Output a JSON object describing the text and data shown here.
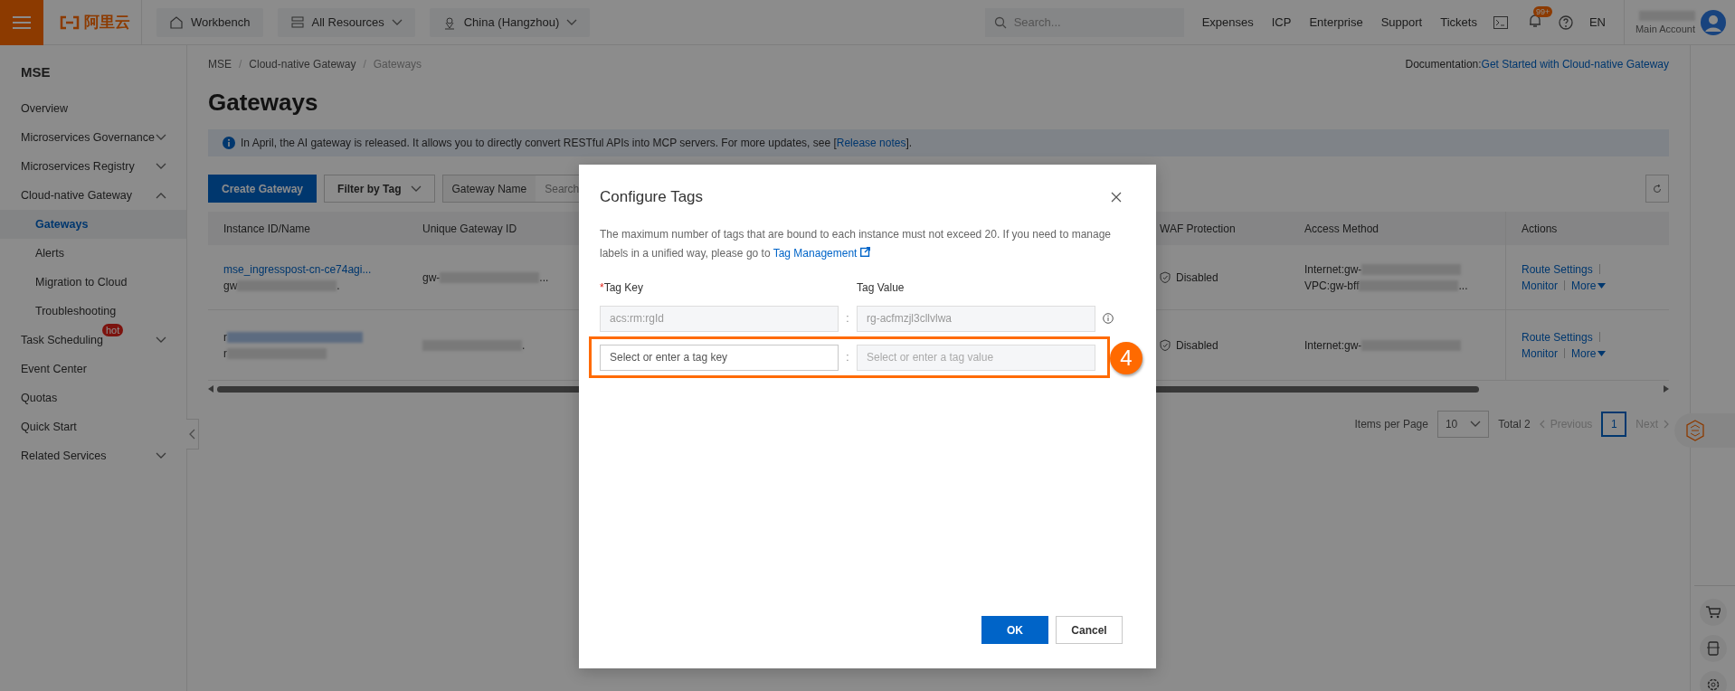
{
  "top_bar": {
    "logo": "阿里云",
    "nav_buttons": [
      {
        "label": "Workbench",
        "dropdown": false
      },
      {
        "label": "All Resources",
        "dropdown": true
      },
      {
        "label": "China (Hangzhou)",
        "dropdown": true
      }
    ],
    "search": {
      "placeholder": "Search..."
    },
    "links": [
      "Expenses",
      "ICP",
      "Enterprise",
      "Support",
      "Tickets"
    ],
    "notification_badge": "99+",
    "language": "EN",
    "account": {
      "type": "Main Account"
    }
  },
  "sidebar": {
    "title": "MSE",
    "items": [
      {
        "label": "Overview",
        "kind": "link",
        "selected": false
      },
      {
        "label": "Microservices Governance",
        "kind": "group",
        "expanded": false,
        "selected": false
      },
      {
        "label": "Microservices Registry",
        "kind": "group",
        "expanded": false,
        "selected": false
      },
      {
        "label": "Cloud-native Gateway",
        "kind": "group",
        "expanded": true,
        "selected": false,
        "children": [
          {
            "label": "Gateways",
            "selected": true
          },
          {
            "label": "Alerts",
            "selected": false
          },
          {
            "label": "Migration to Cloud",
            "selected": false
          },
          {
            "label": "Troubleshooting",
            "selected": false
          }
        ]
      },
      {
        "label": "Task Scheduling",
        "kind": "group",
        "expanded": false,
        "selected": false,
        "badge": "hot"
      },
      {
        "label": "Event Center",
        "kind": "link",
        "selected": false
      },
      {
        "label": "Quotas",
        "kind": "link",
        "selected": false
      },
      {
        "label": "Quick Start",
        "kind": "link",
        "selected": false
      },
      {
        "label": "Related Services",
        "kind": "group",
        "expanded": false,
        "selected": false
      }
    ]
  },
  "main": {
    "breadcrumb": [
      "MSE",
      "Cloud-native Gateway",
      "Gateways"
    ],
    "breadcrumb_separator": "/",
    "documentation": {
      "label": "Documentation:",
      "link": "Get Started with Cloud-native Gateway"
    },
    "title": "Gateways",
    "notice": {
      "text": "In April, the AI gateway is released. It allows you to directly convert RESTful APIs into MCP servers. For more updates, see [",
      "link": "Release notes",
      "after": "]."
    },
    "toolbar": {
      "create_button": "Create Gateway",
      "filter_button": "Filter by Tag",
      "search_select": "Gateway Name",
      "search_placeholder": "Search"
    },
    "table": {
      "columns": [
        "Instance ID/Name",
        "Unique Gateway ID",
        "WAF Protection",
        "Access Method",
        "Actions"
      ],
      "rows": [
        {
          "name_lines": [
            [
              {
                "kind": "link",
                "text": "mse_ingresspost-cn-ce74agi..."
              }
            ],
            [
              {
                "kind": "text",
                "text": "gw"
              },
              {
                "kind": "redacted"
              },
              {
                "kind": "text",
                "text": "."
              }
            ]
          ],
          "gateway_id": [
            {
              "kind": "text",
              "text": "gw-"
            },
            {
              "kind": "redacted"
            },
            {
              "kind": "text",
              "text": "..."
            }
          ],
          "waf": "Disabled",
          "access_lines": [
            [
              {
                "kind": "text",
                "text": "Internet:gw-"
              },
              {
                "kind": "redacted"
              }
            ],
            [
              {
                "kind": "text",
                "text": "VPC:gw-bff"
              },
              {
                "kind": "redacted"
              },
              {
                "kind": "text",
                "text": "..."
              }
            ]
          ],
          "actions": [
            [
              {
                "label": "Route Settings",
                "kind": "link"
              }
            ],
            [
              {
                "label": "Monitor",
                "kind": "link"
              },
              {
                "label": "More",
                "kind": "dropdown"
              }
            ]
          ]
        },
        {
          "name_lines": [
            [
              {
                "kind": "text",
                "text": "r"
              },
              {
                "kind": "redacted-link"
              }
            ],
            [
              {
                "kind": "text",
                "text": "r"
              },
              {
                "kind": "redacted"
              }
            ]
          ],
          "gateway_id": [
            {
              "kind": "redacted"
            },
            {
              "kind": "text",
              "text": "."
            }
          ],
          "waf": "Disabled",
          "access_lines": [
            [
              {
                "kind": "text",
                "text": "Internet:gw-"
              },
              {
                "kind": "redacted"
              }
            ]
          ],
          "actions": [
            [
              {
                "label": "Route Settings",
                "kind": "link"
              }
            ],
            [
              {
                "label": "Monitor",
                "kind": "link"
              },
              {
                "label": "More",
                "kind": "dropdown"
              }
            ]
          ]
        }
      ]
    },
    "pagination": {
      "items_per_page_label": "Items per Page",
      "page_size": "10",
      "total": "Total 2",
      "previous": {
        "label": "Previous",
        "disabled": true
      },
      "pages": [
        {
          "label": "1",
          "selected": true
        }
      ],
      "next": {
        "label": "Next",
        "disabled": true
      }
    }
  },
  "dialog": {
    "title": "Configure Tags",
    "description": {
      "text": "The maximum number of tags that are bound to each instance must not exceed 20. If you need to manage labels in a unified way, please go to ",
      "link": "Tag Management"
    },
    "key_label": {
      "required_mark": "*",
      "text": "Tag Key"
    },
    "value_label": "Tag Value",
    "rows": [
      {
        "key": {
          "value": "acs:rm:rgId",
          "disabled": true
        },
        "separator": ":",
        "value": {
          "value": "rg-acfmzjl3cllvlwa",
          "disabled": true
        },
        "info": true,
        "highlighted": false
      },
      {
        "key": {
          "placeholder": "Select or enter a tag key",
          "disabled": false
        },
        "separator": ":",
        "value": {
          "placeholder": "Select or enter a tag value",
          "disabled": true
        },
        "info": false,
        "highlighted": true,
        "annotation": "4"
      }
    ],
    "buttons": [
      {
        "label": "OK",
        "kind": "primary"
      },
      {
        "label": "Cancel",
        "kind": "secondary"
      }
    ]
  }
}
